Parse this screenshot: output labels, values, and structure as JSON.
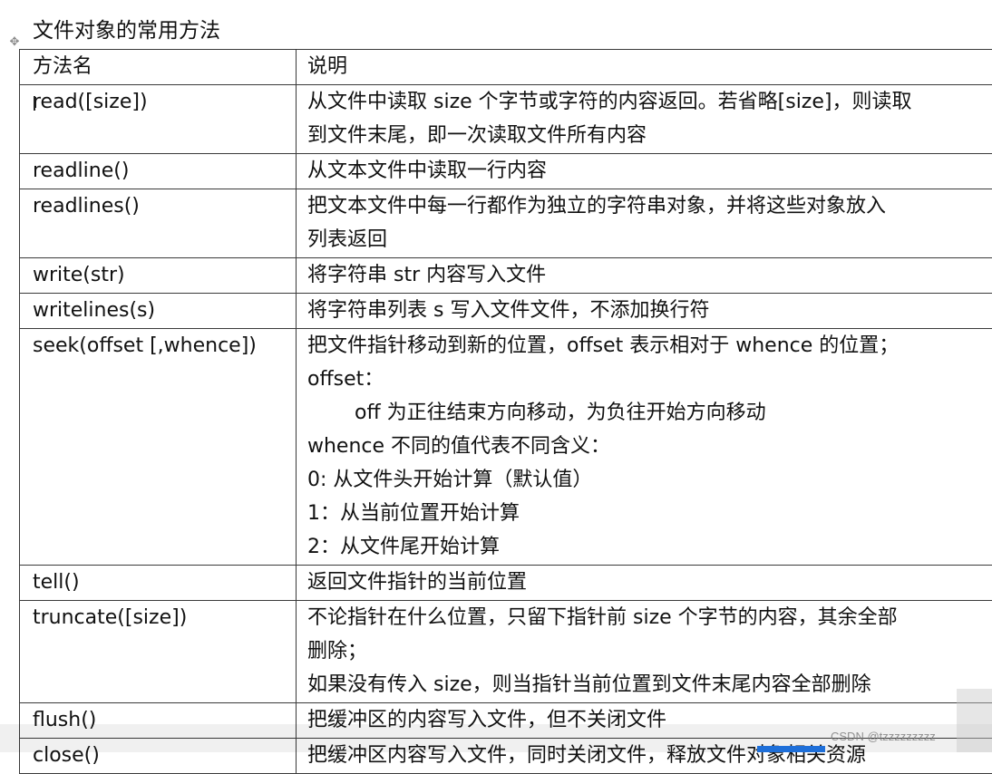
{
  "document": {
    "title": "文件对象的常用方法",
    "watermark": "CSDN @tzzzzzzzzz"
  },
  "table": {
    "headers": [
      "方法名",
      "说明"
    ],
    "rows": [
      {
        "method": "read([size])",
        "lines": [
          "从文件中读取 size 个字节或字符的内容返回。若省略[size]，则读取",
          "到文件末尾，即一次读取文件所有内容"
        ]
      },
      {
        "method": "readline()",
        "lines": [
          "从文本文件中读取一行内容"
        ]
      },
      {
        "method": "readlines()",
        "lines": [
          "把文本文件中每一行都作为独立的字符串对象，并将这些对象放入",
          "列表返回"
        ]
      },
      {
        "method": "write(str)",
        "lines": [
          "将字符串 str 内容写入文件"
        ]
      },
      {
        "method": "writelines(s)",
        "lines": [
          "将字符串列表 s 写入文件文件，不添加换行符"
        ]
      },
      {
        "method": "seek(offset [,whence])",
        "lines": [
          "把文件指针移动到新的位置，offset 表示相对于 whence 的位置；",
          "offset：",
          "off 为正往结束方向移动，为负往开始方向移动",
          "whence 不同的值代表不同含义：",
          "0: 从文件头开始计算（默认值）",
          "1：从当前位置开始计算",
          "2：从文件尾开始计算"
        ]
      },
      {
        "method": "tell()",
        "lines": [
          "返回文件指针的当前位置"
        ]
      },
      {
        "method": "truncate([size])",
        "lines": [
          "不论指针在什么位置，只留下指针前 size 个字节的内容，其余全部",
          "删除；",
          "如果没有传入 size，则当指针当前位置到文件末尾内容全部删除"
        ]
      },
      {
        "method": "flush()",
        "lines": [
          "把缓冲区的内容写入文件，但不关闭文件"
        ]
      },
      {
        "method": "close()",
        "lines": [
          "把缓冲区内容写入文件，同时关闭文件，释放文件对象相关资源"
        ]
      }
    ]
  }
}
